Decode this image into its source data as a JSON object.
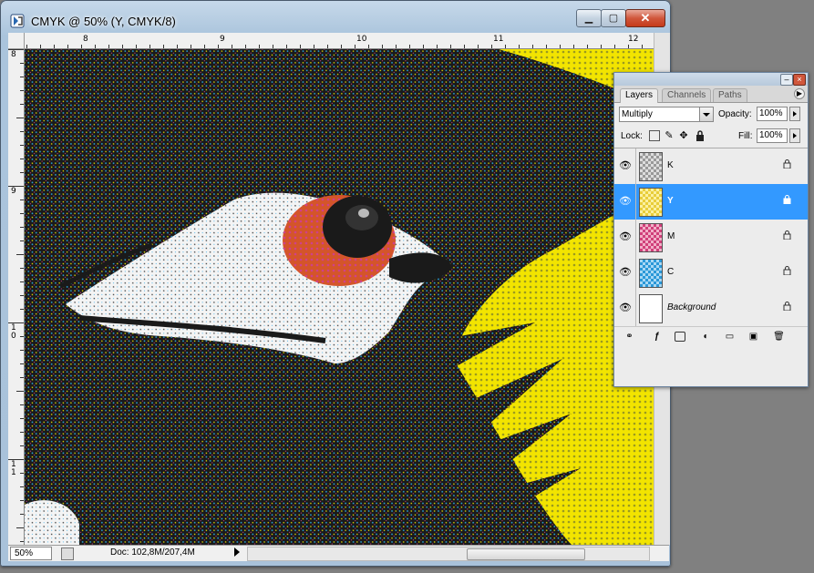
{
  "window": {
    "title": "CMYK @ 50% (Y, CMYK/8)",
    "minimize_glyph": "▁",
    "maximize_glyph": "▢",
    "close_glyph": "✕"
  },
  "rulers": {
    "horizontal": [
      "8",
      "9",
      "10",
      "11",
      "12"
    ],
    "vertical": [
      "8",
      "9",
      "1\n0",
      "1\n1"
    ]
  },
  "statusbar": {
    "zoom": "50%",
    "doc_info": "Doc: 102,8M/207,4M"
  },
  "layers_panel": {
    "tabs": [
      "Layers",
      "Channels",
      "Paths"
    ],
    "active_tab": "Layers",
    "blend_mode": "Multiply",
    "opacity_label": "Opacity:",
    "opacity_value": "100%",
    "lock_label": "Lock:",
    "fill_label": "Fill:",
    "fill_value": "100%",
    "layers": [
      {
        "name": "K",
        "visible": true,
        "selected": false,
        "thumb": "#555555"
      },
      {
        "name": "Y",
        "visible": true,
        "selected": true,
        "thumb": "#f5e04a"
      },
      {
        "name": "M",
        "visible": true,
        "selected": false,
        "thumb": "#e05a8a"
      },
      {
        "name": "C",
        "visible": true,
        "selected": false,
        "thumb": "#3aa8e0"
      },
      {
        "name": "Background",
        "visible": true,
        "selected": false,
        "thumb": "#ffffff"
      }
    ],
    "footer_icons": [
      "link-icon",
      "fx-icon",
      "mask-icon",
      "adjustment-icon",
      "group-icon",
      "new-layer-icon",
      "trash-icon"
    ]
  },
  "colors": {
    "yellow": "#f2e400",
    "black": "#111111",
    "magenta": "#d0408a",
    "cyan": "#2aa8e8",
    "selected_layer": "#3399ff"
  }
}
